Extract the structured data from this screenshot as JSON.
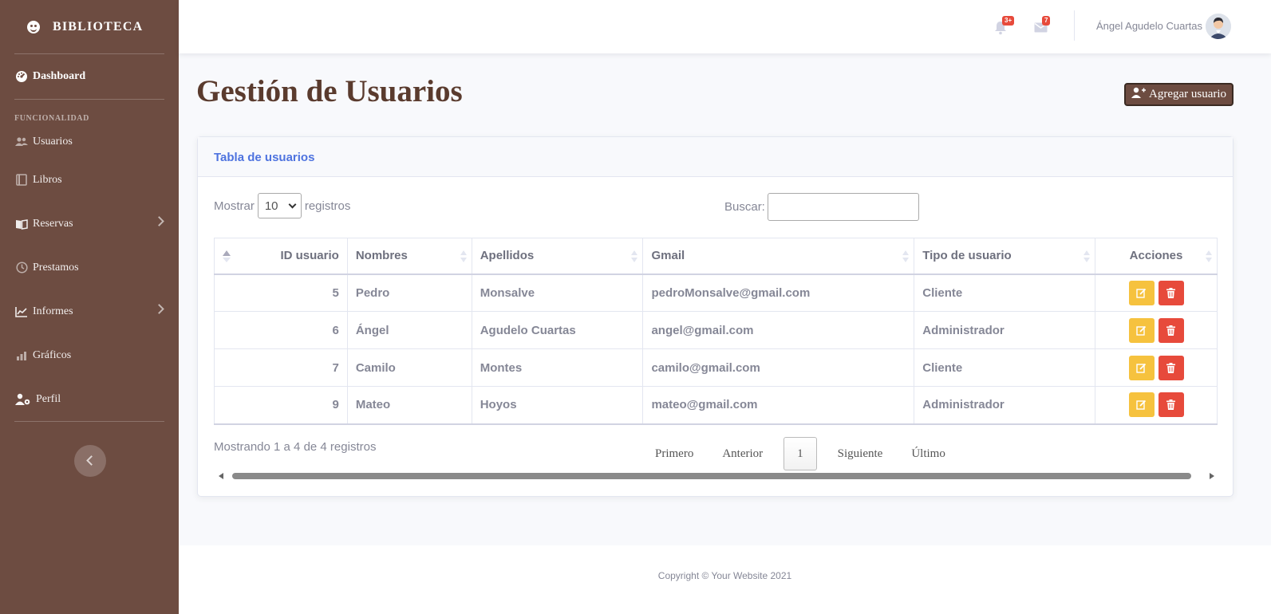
{
  "sidebar": {
    "brand": "BIBLIOTECA",
    "dashboard": "Dashboard",
    "section_heading": "FUNCIONALIDAD",
    "items": [
      {
        "label": "Usuarios"
      },
      {
        "label": "Libros"
      },
      {
        "label": "Reservas"
      },
      {
        "label": "Prestamos"
      },
      {
        "label": "Informes"
      },
      {
        "label": "Gráficos"
      },
      {
        "label": "Perfil"
      }
    ]
  },
  "topbar": {
    "alerts_badge": "3+",
    "messages_badge": "7",
    "user_name": "Ángel Agudelo Cuartas"
  },
  "page": {
    "title": "Gestión de Usuarios",
    "add_button": "Agregar usuario"
  },
  "card": {
    "title": "Tabla de usuarios",
    "show_label": "Mostrar",
    "show_value": "10",
    "records_label": "registros",
    "search_label": "Buscar:",
    "search_value": ""
  },
  "table": {
    "headers": [
      "ID usuario",
      "Nombres",
      "Apellidos",
      "Gmail",
      "Tipo de usuario",
      "Acciones"
    ],
    "rows": [
      {
        "id": "5",
        "nombres": "Pedro",
        "apellidos": "Monsalve",
        "gmail": "pedroMonsalve@gmail.com",
        "tipo": "Cliente"
      },
      {
        "id": "6",
        "nombres": "Ángel",
        "apellidos": "Agudelo Cuartas",
        "gmail": "angel@gmail.com",
        "tipo": "Administrador"
      },
      {
        "id": "7",
        "nombres": "Camilo",
        "apellidos": "Montes",
        "gmail": "camilo@gmail.com",
        "tipo": "Cliente"
      },
      {
        "id": "9",
        "nombres": "Mateo",
        "apellidos": "Hoyos",
        "gmail": "mateo@gmail.com",
        "tipo": "Administrador"
      }
    ]
  },
  "pagination": {
    "info": "Mostrando 1 a 4 de 4 registros",
    "first": "Primero",
    "previous": "Anterior",
    "current": "1",
    "next": "Siguiente",
    "last": "Último"
  },
  "footer": {
    "copyright": "Copyright © Your Website 2021"
  },
  "colors": {
    "sidebar": "#6d4c41",
    "primary": "#4e73df",
    "warning": "#f6c23e",
    "danger": "#e74a3b"
  }
}
